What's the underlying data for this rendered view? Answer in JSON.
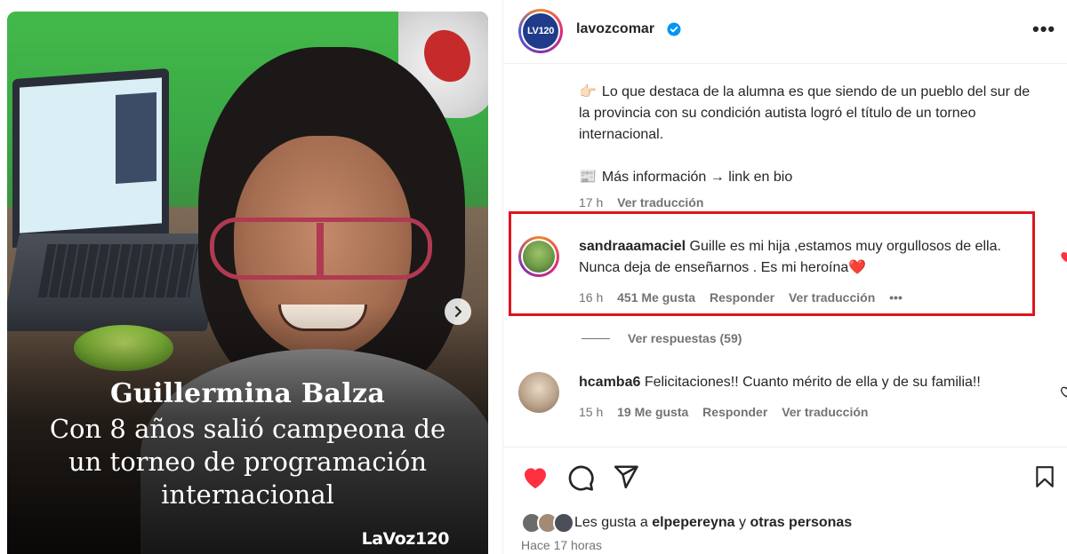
{
  "post": {
    "image": {
      "headline_name": "Guillermina Balza",
      "headline_lines": [
        "Con 8 años salió campeona de",
        "un torneo de programación",
        "internacional"
      ],
      "brand": "LaVoz120",
      "next_icon": "chevron-right-icon"
    },
    "header": {
      "avatar_logo": "LV120",
      "username": "lavozcomar",
      "verified_icon": "verified-badge-icon",
      "more_icon": "more-options-icon",
      "more_label": "•••"
    },
    "caption": {
      "para1_emoji": "👉🏻",
      "para1": "Lo que destaca de la alumna es que siendo de un pueblo del sur de la provincia con su condición autista logró el título de un torneo internacional.",
      "para2_emoji": "📰",
      "para2": "Más información → link en bio",
      "time": "17 h",
      "translate": "Ver traducción"
    },
    "comments": [
      {
        "user": "sandraaamaciel",
        "text": "Guille es mi hija ,estamos muy orgullosos de ella. Nunca deja de enseñarnos . Es mi heroína",
        "text_emoji": "❤️",
        "time": "16 h",
        "likes": "451 Me gusta",
        "reply": "Responder",
        "translate": "Ver traducción",
        "more": "•••",
        "liked": true,
        "view_replies": "Ver respuestas (59)"
      },
      {
        "user": "hcamba6",
        "text": "Felicitaciones!! Cuanto mérito de ella y de su familia!!",
        "time": "15 h",
        "likes": "19 Me gusta",
        "reply": "Responder",
        "translate": "Ver traducción",
        "liked": false
      }
    ],
    "actions": {
      "like_icon": "heart-filled-icon",
      "comment_icon": "comment-icon",
      "share_icon": "share-icon",
      "save_icon": "bookmark-icon"
    },
    "likes_prefix": "Les gusta a",
    "likes_user": "elpepereyna",
    "likes_and": "y",
    "likes_others": "otras personas",
    "posted": "Hace 17 horas"
  },
  "colors": {
    "like_red": "#ff3040",
    "highlight": "#e0141e",
    "verified_blue": "#0095f6",
    "muted": "#737373"
  }
}
